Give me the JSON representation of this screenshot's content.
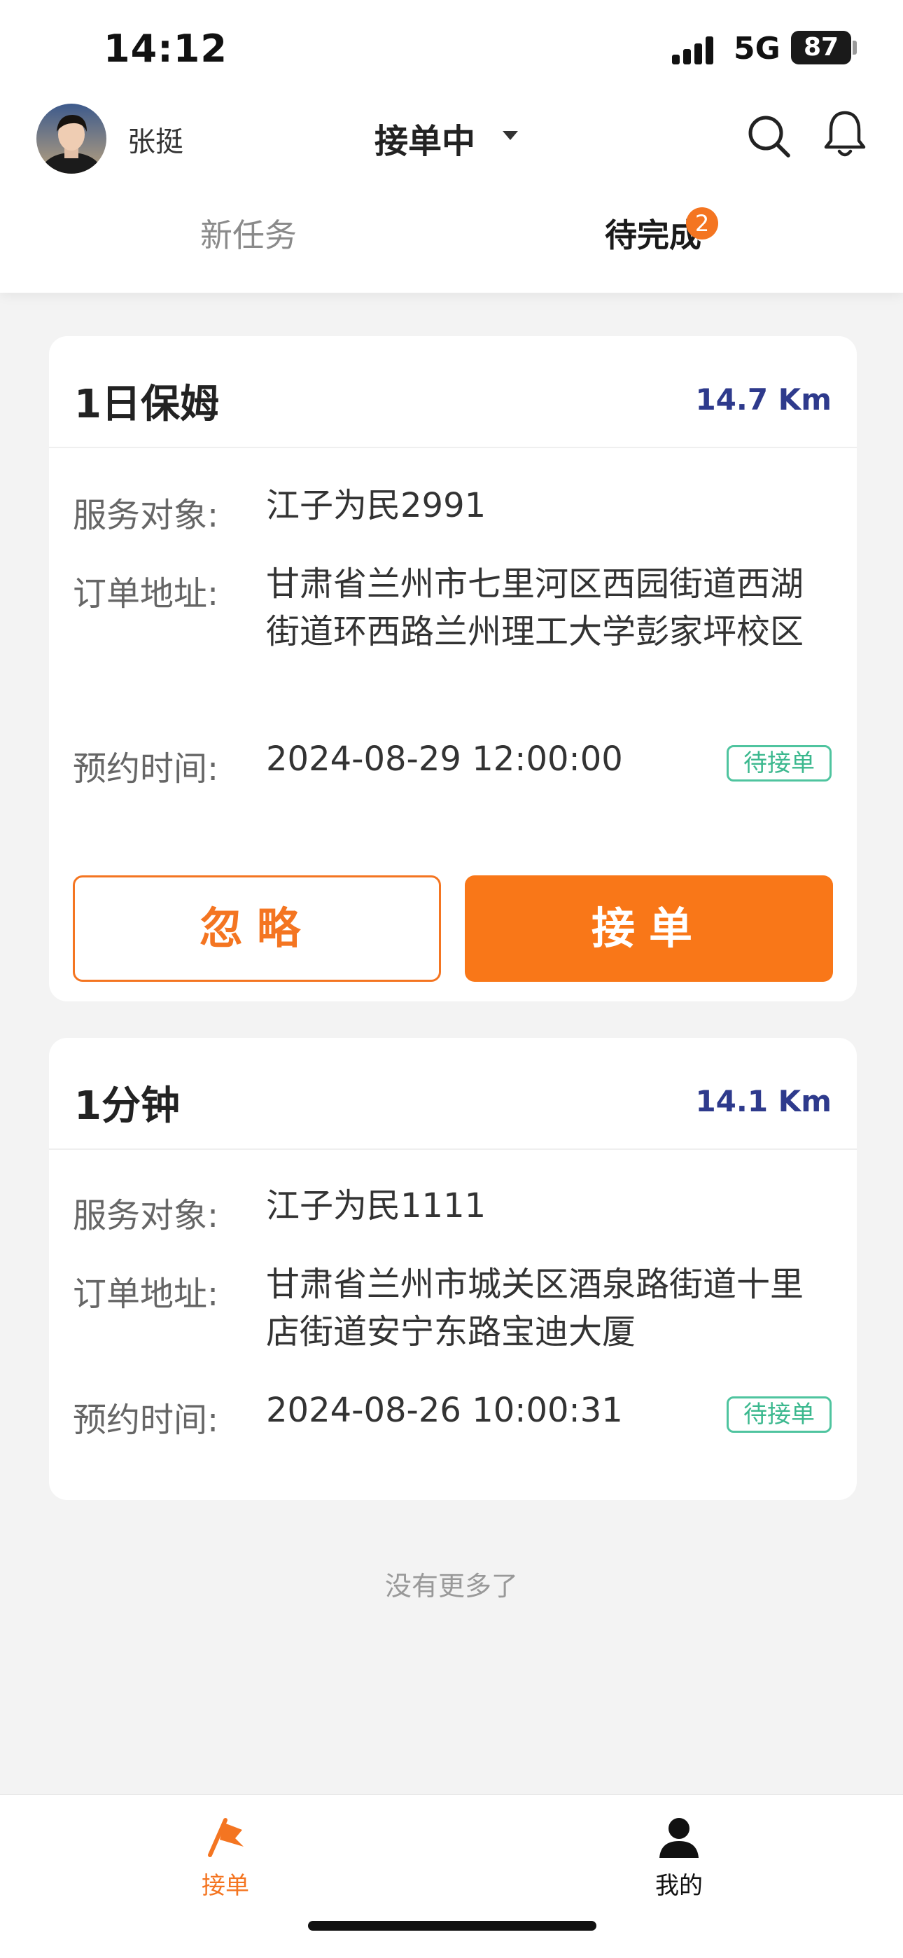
{
  "status_bar": {
    "time": "14:12",
    "network": "5G",
    "battery": "87"
  },
  "header": {
    "username": "张挺",
    "work_status": "接单中"
  },
  "tabs": [
    {
      "label": "新任务",
      "active": false
    },
    {
      "label": "待完成",
      "active": true,
      "badge": "2"
    }
  ],
  "orders": [
    {
      "title": "1日保姆",
      "distance": "14.7 Km",
      "service_target_label": "服务对象:",
      "service_target": "江子为民2991",
      "address_label": "订单地址:",
      "address": "甘肃省兰州市七里河区西园街道西湖街道环西路兰州理工大学彭家坪校区",
      "time_label": "预约时间:",
      "time": "2024-08-29 12:00:00",
      "status": "待接单",
      "ignore_label": "忽略",
      "accept_label": "接单"
    },
    {
      "title": "1分钟",
      "distance": "14.1 Km",
      "service_target_label": "服务对象:",
      "service_target": "江子为民1111",
      "address_label": "订单地址:",
      "address": "甘肃省兰州市城关区酒泉路街道十里店街道安宁东路宝迪大厦",
      "time_label": "预约时间:",
      "time": "2024-08-26 10:00:31",
      "status": "待接单"
    }
  ],
  "footer_text": "没有更多了",
  "bottom_nav": [
    {
      "label": "接单",
      "icon": "flag-icon",
      "active": true,
      "color": "#f47521"
    },
    {
      "label": "我的",
      "icon": "person-icon",
      "active": false,
      "color": "#111111"
    }
  ],
  "colors": {
    "accent": "#f97718",
    "distance": "#2e3a8c",
    "status_tag": "#3bb88e"
  }
}
